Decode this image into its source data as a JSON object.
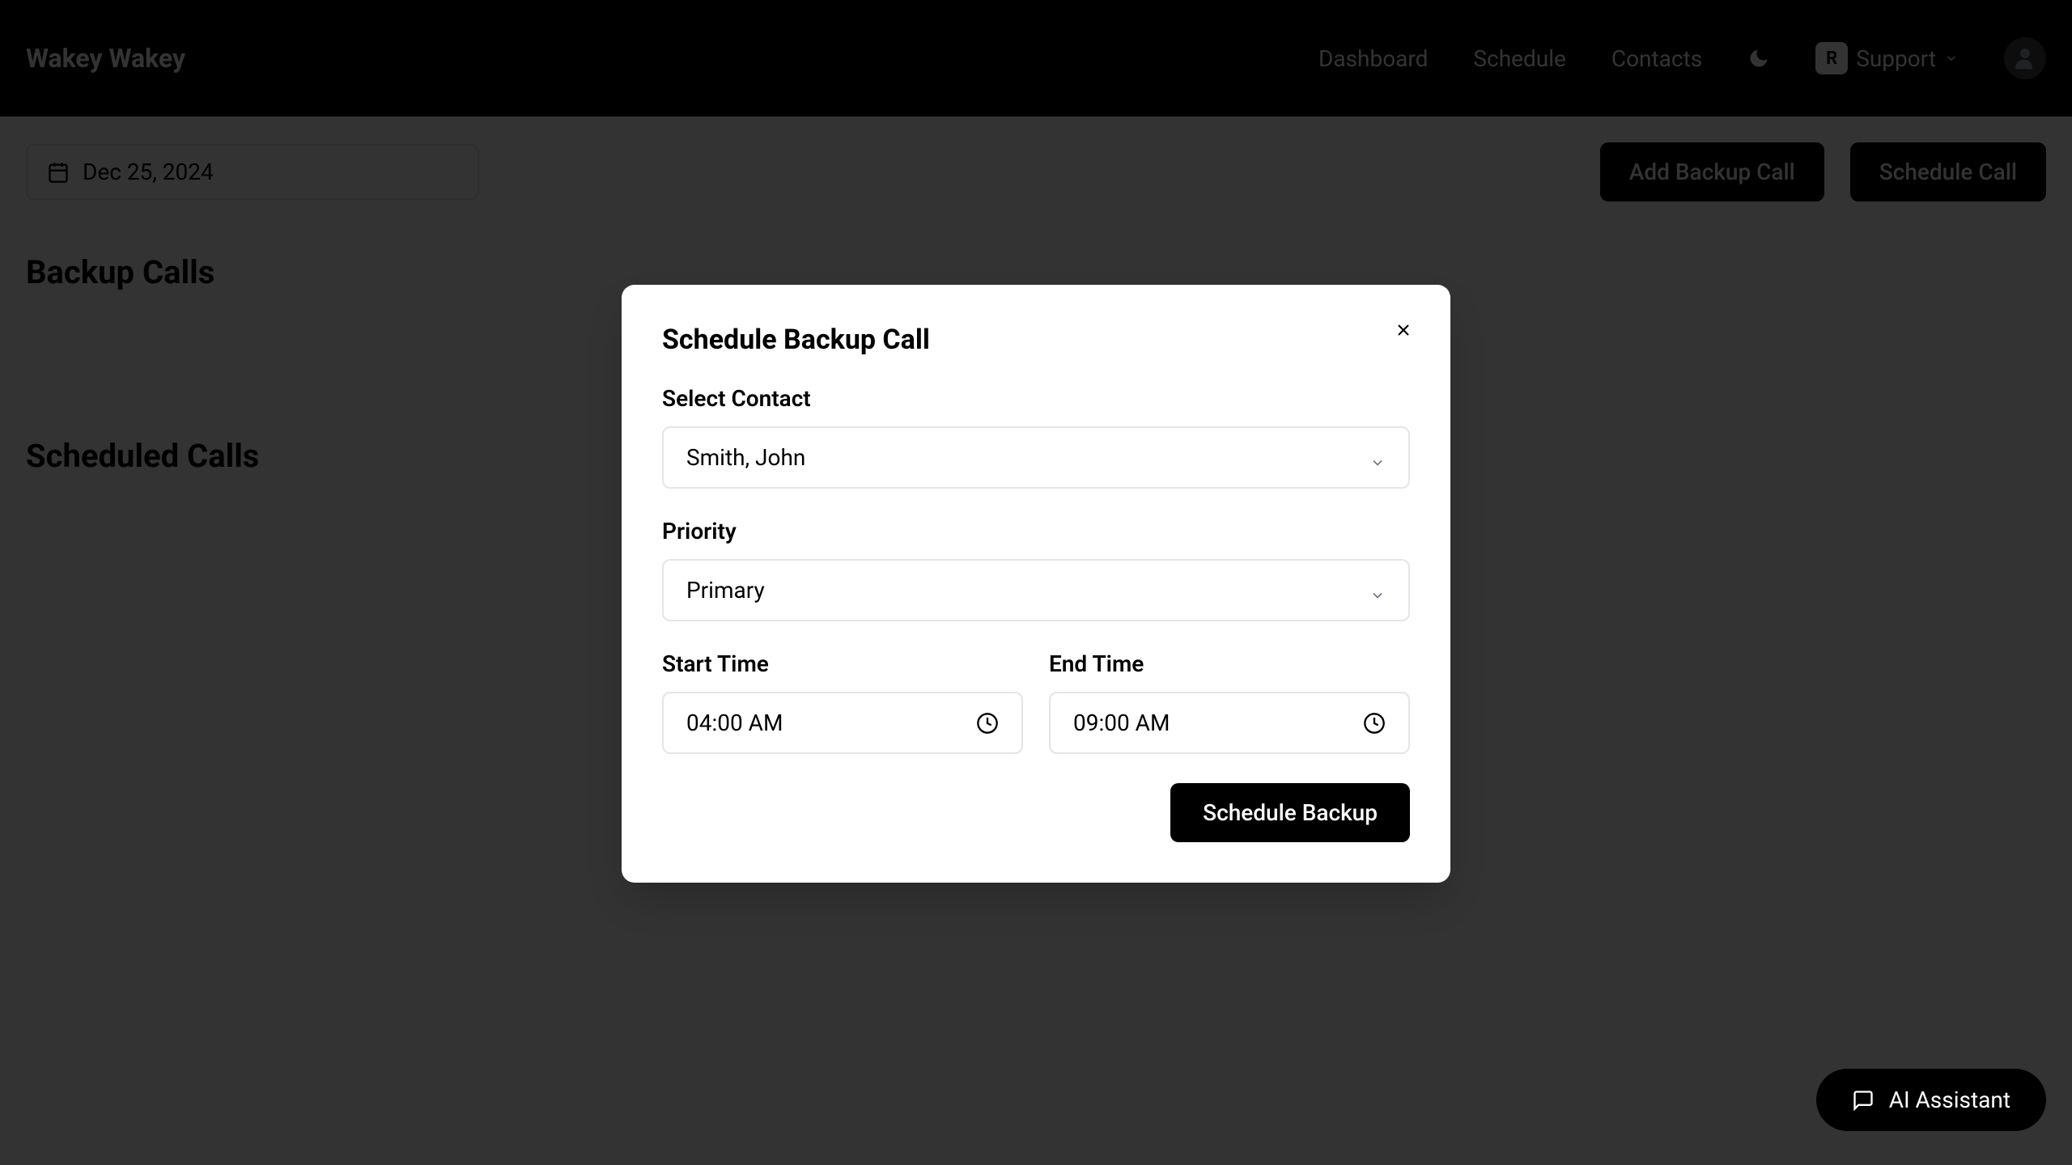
{
  "header": {
    "app_title": "Wakey Wakey",
    "nav": {
      "dashboard": "Dashboard",
      "schedule": "Schedule",
      "contacts": "Contacts"
    },
    "support": {
      "badge": "R",
      "label": "Support"
    }
  },
  "main": {
    "date": "Dec 25, 2024",
    "add_backup_button": "Add Backup Call",
    "schedule_call_button": "Schedule Call",
    "backup_calls_title": "Backup Calls",
    "scheduled_calls_title": "Scheduled Calls"
  },
  "modal": {
    "title": "Schedule Backup Call",
    "contact_label": "Select Contact",
    "contact_value": "Smith, John",
    "priority_label": "Priority",
    "priority_value": "Primary",
    "start_time_label": "Start Time",
    "start_time_value": "04:00 AM",
    "end_time_label": "End Time",
    "end_time_value": "09:00 AM",
    "submit_label": "Schedule Backup"
  },
  "ai_assistant": {
    "label": "AI Assistant"
  }
}
